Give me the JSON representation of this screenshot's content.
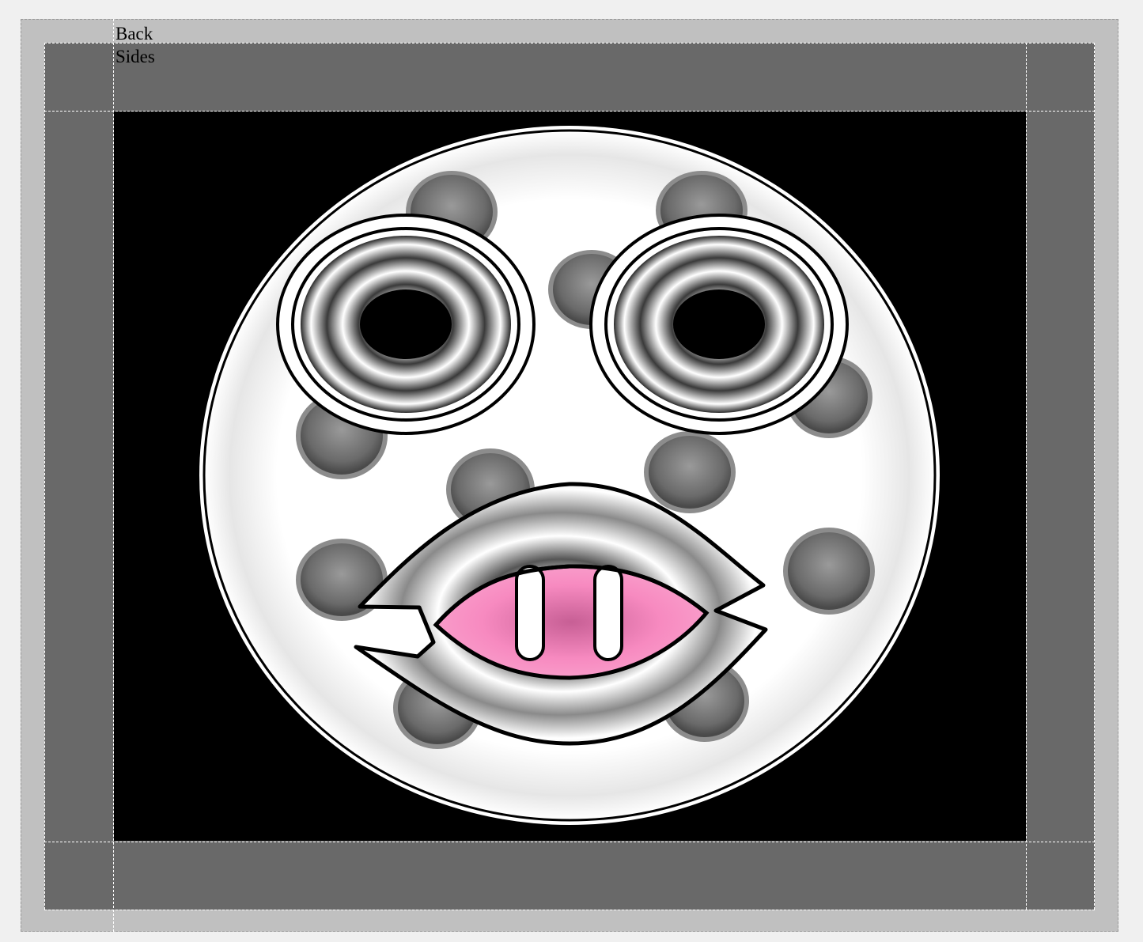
{
  "labels": {
    "back": "Back",
    "sides": "Sides"
  },
  "colors": {
    "outer_frame": "#c0c0c0",
    "side_panel": "#696969",
    "back_panel": "#000000",
    "face": "#ffffff",
    "spot": "#8c8c8c",
    "tongue": "#f78ac0",
    "outline": "#000000"
  },
  "icons": [
    "face-icon",
    "eye-icon",
    "spot-icon",
    "mouth-icon",
    "tooth-icon"
  ]
}
